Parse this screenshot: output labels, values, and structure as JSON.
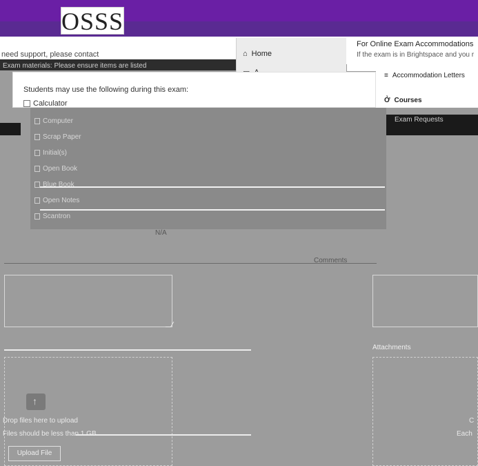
{
  "header": {
    "logo_text": "OSSS"
  },
  "notice": {
    "contact_text": "need support, please contact",
    "strip_text": "Exam materials: Please ensure items are listed"
  },
  "nav": {
    "home": "Home",
    "a_item": "A",
    "accommodation_letters": "Accommodation Letters",
    "courses": "Courses",
    "exam_requests": "Exam Requests"
  },
  "online_panel": {
    "title": "For Online Exam Accommodations",
    "subtitle": "If the exam is in Brightspace and you r"
  },
  "exam": {
    "lead": "Students may use the following during this exam:",
    "options": [
      "Calculator",
      "Computer",
      "Scrap Paper",
      "Initial(s)",
      "Open Book",
      "Blue Book",
      "Open Notes",
      "Scantron"
    ],
    "na": "N/A",
    "comments_label": "Comments"
  },
  "attachments": {
    "label": "Attachments",
    "drop_text": "Drop files here to upload",
    "size_hint": "Files should be less than 1 GB",
    "upload_button": "Upload File",
    "right_c": "C",
    "right_each": "Each"
  }
}
